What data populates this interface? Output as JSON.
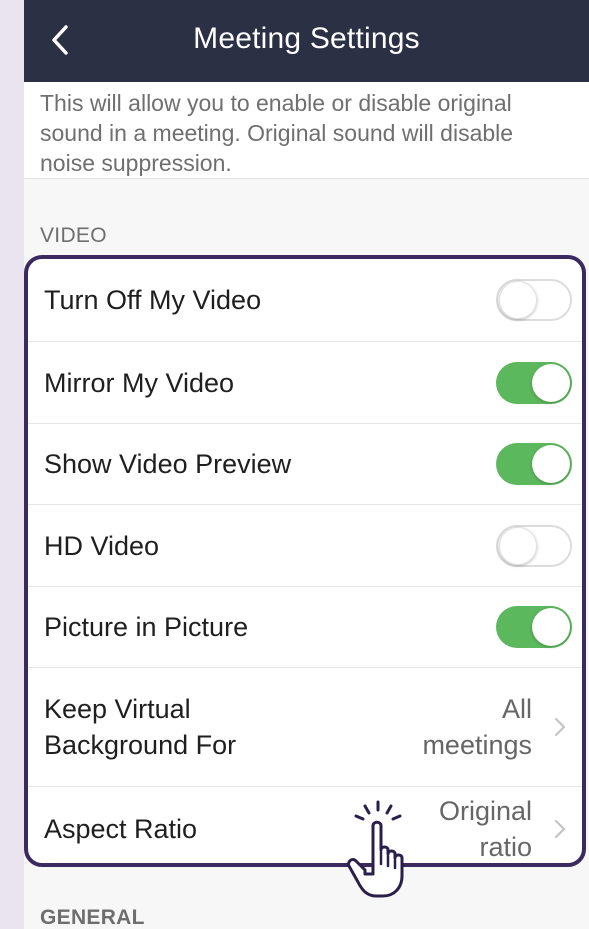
{
  "header": {
    "title": "Meeting Settings",
    "back_icon": "chevron-left-icon"
  },
  "description": "This will allow you to enable or disable original sound in a meeting. Original sound will disable noise suppression.",
  "sections": {
    "video": "VIDEO",
    "general": "GENERAL"
  },
  "video_settings": [
    {
      "label": "Turn Off My Video",
      "type": "toggle",
      "on": false
    },
    {
      "label": "Mirror My Video",
      "type": "toggle",
      "on": true
    },
    {
      "label": "Show Video Preview",
      "type": "toggle",
      "on": true
    },
    {
      "label": "HD Video",
      "type": "toggle",
      "on": false
    },
    {
      "label": "Picture in Picture",
      "type": "toggle",
      "on": true
    },
    {
      "label_line1": "Keep Virtual",
      "label_line2": "Background For",
      "type": "link",
      "value_line1": "All",
      "value_line2": "meetings"
    },
    {
      "label": "Aspect Ratio",
      "type": "link",
      "value_line1": "Original",
      "value_line2": "ratio"
    }
  ],
  "colors": {
    "header_bg": "#2b3044",
    "toggle_on": "#5cb85c",
    "highlight_border": "#3b2a60"
  },
  "pointer_icon": "pointer-hand-icon"
}
